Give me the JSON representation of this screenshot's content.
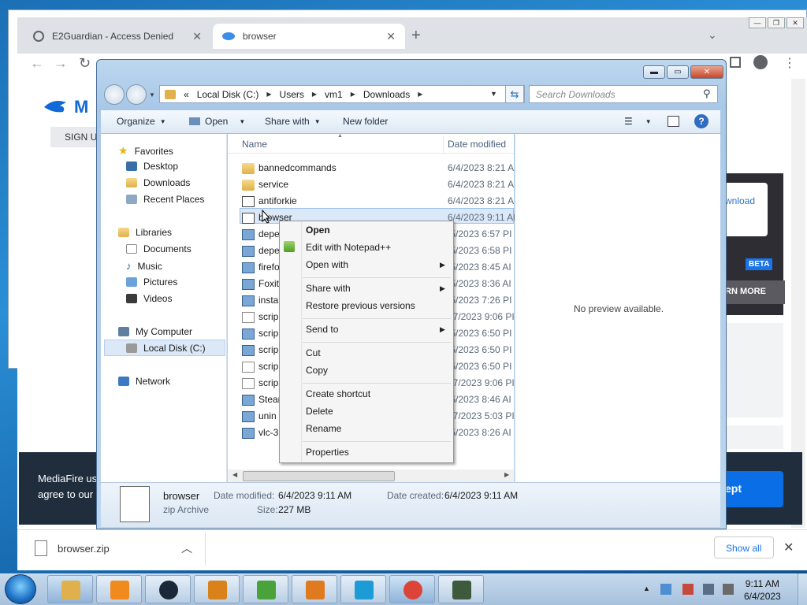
{
  "browser": {
    "tabs": [
      {
        "label": "E2Guardian - Access Denied",
        "icon": "globe-icon",
        "active": false
      },
      {
        "label": "browser",
        "icon": "e2guardian-icon",
        "active": true
      }
    ],
    "new_tab": "+",
    "tab_menu": "⌄"
  },
  "page": {
    "signup": "SIGN U",
    "download_link": "wnload",
    "beta": "BETA",
    "learn_more": "RN MORE",
    "banner_text": "MediaFire us agree to our",
    "accept": "ept"
  },
  "download_shelf": {
    "file": "browser.zip",
    "show_all": "Show all"
  },
  "explorer": {
    "path": [
      "Local Disk (C:)",
      "Users",
      "vm1",
      "Downloads"
    ],
    "path_prefix": "«",
    "search_placeholder": "Search Downloads",
    "commands": {
      "organize": "Organize",
      "open": "Open",
      "share_with": "Share with",
      "new_folder": "New folder"
    },
    "nav": {
      "favorites": "Favorites",
      "favorites_items": [
        "Desktop",
        "Downloads",
        "Recent Places"
      ],
      "libraries": "Libraries",
      "library_items": [
        "Documents",
        "Music",
        "Pictures",
        "Videos"
      ],
      "computer": "My Computer",
      "computer_items": [
        "Local Disk (C:)"
      ],
      "network": "Network"
    },
    "columns": {
      "name": "Name",
      "date": "Date modified"
    },
    "files": [
      {
        "name": "bannedcommands",
        "date": "6/4/2023 8:21 AI"
      },
      {
        "name": "service",
        "date": "6/4/2023 8:21 AI"
      },
      {
        "name": "antiforkie",
        "date": "6/4/2023 8:21 AI"
      },
      {
        "name": "browser",
        "date": "6/4/2023 9:11 AI"
      },
      {
        "name": "depe",
        "date": "/5/2023 6:57 PI"
      },
      {
        "name": "depe",
        "date": "/5/2023 6:58 PI"
      },
      {
        "name": "firefo",
        "date": "/5/2023 8:45 AI"
      },
      {
        "name": "Foxit",
        "date": "/5/2023 8:36 AI"
      },
      {
        "name": "insta",
        "date": "/5/2023 7:26 PI"
      },
      {
        "name": "scrip",
        "date": "27/2023 9:06 PI"
      },
      {
        "name": "scrip",
        "date": "/5/2023 6:50 PI"
      },
      {
        "name": "scrip",
        "date": "/5/2023 6:50 PI"
      },
      {
        "name": "scrip",
        "date": "/5/2023 6:50 PI"
      },
      {
        "name": "scrip",
        "date": "27/2023 9:06 PI"
      },
      {
        "name": "Stear",
        "date": "/5/2023 8:46 AI"
      },
      {
        "name": "unin",
        "date": "17/2023 5:03 PI"
      },
      {
        "name": "vlc-3",
        "date": "/5/2023 8:26 AI"
      }
    ],
    "preview_text": "No preview available.",
    "details": {
      "name": "browser",
      "type": "zip Archive",
      "modified_label": "Date modified:",
      "modified_value": "6/4/2023 9:11 AM",
      "created_label": "Date created:",
      "created_value": "6/4/2023 9:11 AM",
      "size_label": "Size:",
      "size_value": "227 MB"
    }
  },
  "context_menu": {
    "items": [
      "Open",
      "Edit with Notepad++",
      "Open with",
      "Share with",
      "Restore previous versions",
      "Send to",
      "Cut",
      "Copy",
      "Create shortcut",
      "Delete",
      "Rename",
      "Properties"
    ]
  },
  "taskbar": {
    "time": "9:11 AM",
    "date": "6/4/2023",
    "apps": [
      "explorer",
      "vlc",
      "steam",
      "search",
      "notepad++",
      "media",
      "thunder",
      "chrome",
      "monitor"
    ]
  }
}
